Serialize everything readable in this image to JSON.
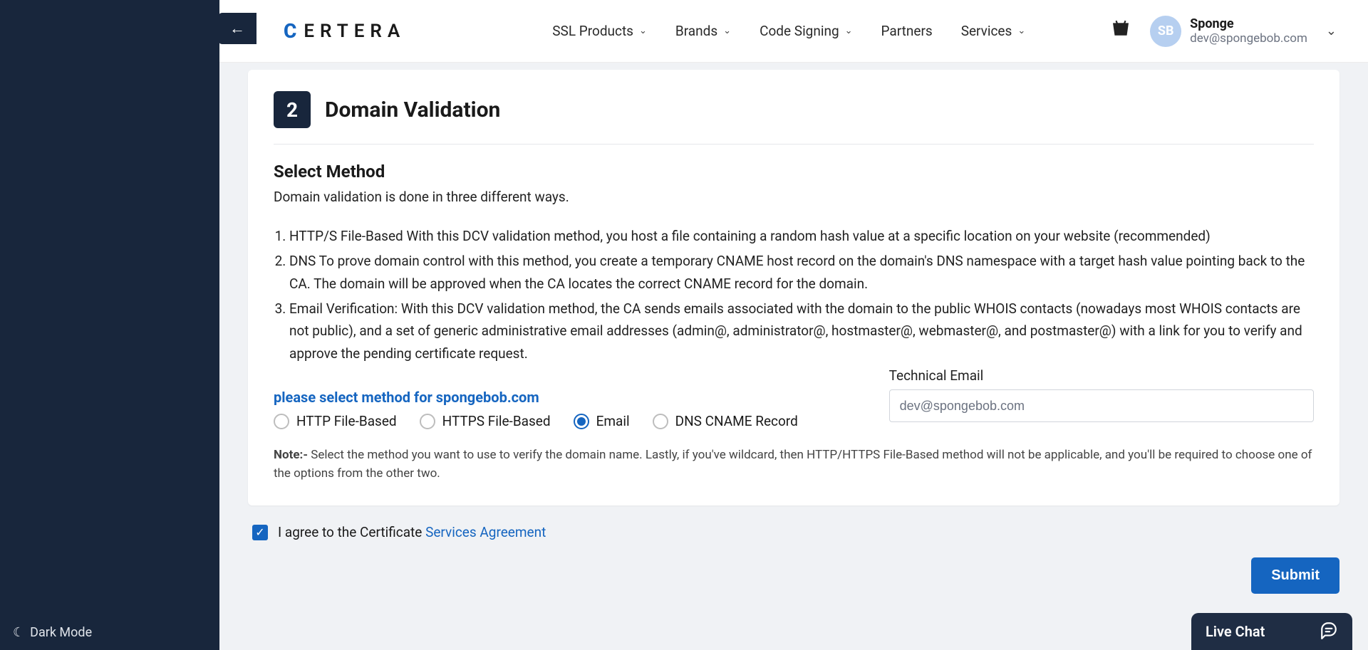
{
  "brand": "ERTERA",
  "nav": {
    "ssl": "SSL Products",
    "brands": "Brands",
    "code": "Code Signing",
    "partners": "Partners",
    "services": "Services"
  },
  "user": {
    "initials": "SB",
    "name": "Sponge",
    "email": "dev@spongebob.com"
  },
  "dark_mode": "Dark Mode",
  "step": {
    "num": "2",
    "title": "Domain Validation"
  },
  "section": {
    "select_method": "Select Method",
    "intro": "Domain validation is done in three different ways.",
    "methods": {
      "m1": "HTTP/S File-Based With this DCV validation method, you host a file containing a random hash value at a specific location on your website (recommended)",
      "m2": "DNS To prove domain control with this method, you create a temporary CNAME host record on the domain's DNS namespace with a target hash value pointing back to the CA. The domain will be approved when the CA locates the correct CNAME record for the domain.",
      "m3": "Email Verification: With this DCV validation method, the CA sends emails associated with the domain to the public WHOIS contacts (nowadays most WHOIS contacts are not public), and a set of generic administrative email addresses (admin@, administrator@, hostmaster@, webmaster@, and postmaster@) with a link for you to verify and approve the pending certificate request."
    },
    "prompt": "please select method for spongebob.com",
    "radios": {
      "http": "HTTP File-Based",
      "https": "HTTPS File-Based",
      "email": "Email",
      "dns": "DNS CNAME Record",
      "selected": "email"
    },
    "tech_email_label": "Technical Email",
    "tech_email_value": "dev@spongebob.com",
    "note_label": "Note:- ",
    "note_text": "Select the method you want to use to verify the domain name. Lastly, if you've wildcard, then HTTP/HTTPS File-Based method will not be applicable, and you'll be required to choose one of the options from the other two."
  },
  "agree": {
    "prefix": "I agree to the Certificate ",
    "link": "Services Agreement"
  },
  "submit": "Submit",
  "live_chat": "Live Chat"
}
